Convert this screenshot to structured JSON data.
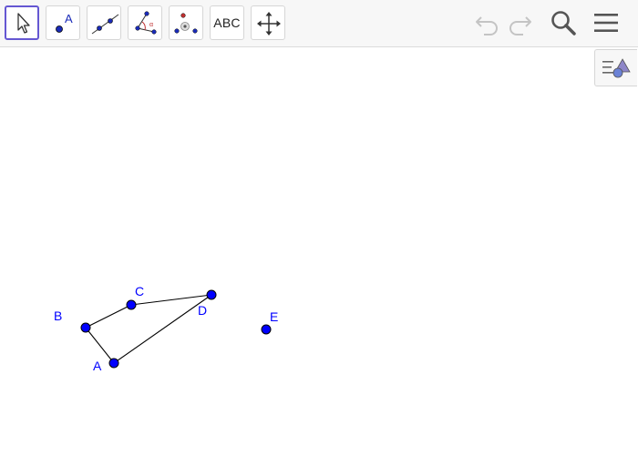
{
  "toolbar": {
    "tools": [
      {
        "name": "move",
        "selected": true
      },
      {
        "name": "point",
        "label": "A"
      },
      {
        "name": "line"
      },
      {
        "name": "angle"
      },
      {
        "name": "reflect"
      },
      {
        "name": "text",
        "label": "ABC"
      },
      {
        "name": "move-graphics-view"
      }
    ],
    "right_buttons": [
      "undo-icon",
      "redo-icon",
      "search-icon",
      "menu-icon"
    ]
  },
  "algebra_toggle_icon": "algebra-view-icon",
  "construction": {
    "points": [
      {
        "label": "A"
      },
      {
        "label": "B"
      },
      {
        "label": "C"
      },
      {
        "label": "D"
      },
      {
        "label": "E"
      }
    ],
    "segments": [
      [
        "A",
        "B"
      ],
      [
        "B",
        "C"
      ],
      [
        "C",
        "D"
      ],
      [
        "D",
        "A"
      ]
    ],
    "colors": {
      "point_fill": "#0000ff",
      "point_stroke": "#000000",
      "label": "#0000ff",
      "segment": "#000000",
      "accent": "#6557d2"
    }
  }
}
